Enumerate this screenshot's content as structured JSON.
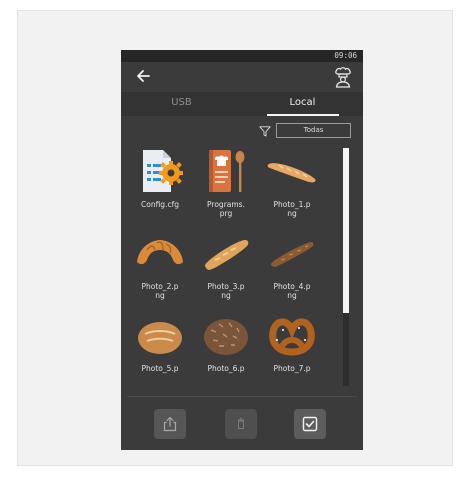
{
  "status": {
    "time": "09:06"
  },
  "header": {
    "back_icon": "arrow-left-icon",
    "user_icon": "chef-icon"
  },
  "tabs": [
    {
      "label": "USB",
      "active": false
    },
    {
      "label": "Local",
      "active": true
    }
  ],
  "filter": {
    "icon": "filter-funnel-icon",
    "selected": "Todas"
  },
  "files": [
    {
      "name": "Config.cfg",
      "icon": "config-file-icon"
    },
    {
      "name": "Programs.prg",
      "icon": "recipe-book-icon"
    },
    {
      "name": "Photo_1.png",
      "icon": "baguette-image"
    },
    {
      "name": "Photo_2.png",
      "icon": "croissant-image"
    },
    {
      "name": "Photo_3.png",
      "icon": "bread-loaf-image"
    },
    {
      "name": "Photo_4.png",
      "icon": "dark-baguette-image"
    },
    {
      "name": "Photo_5.png",
      "icon": "round-bread-image"
    },
    {
      "name": "Photo_6.png",
      "icon": "rye-bread-image"
    },
    {
      "name": "Photo_7.png",
      "icon": "pretzel-image"
    }
  ],
  "visible_labels": [
    "Config.cfg",
    "Programs.\nprg",
    "Photo_1.p\nng",
    "Photo_2.p\nng",
    "Photo_3.p\nng",
    "Photo_4.p\nng",
    "Photo_5.p",
    "Photo_6.p",
    "Photo_7.p"
  ],
  "actions": [
    {
      "name": "export",
      "icon": "share-upload-icon",
      "enabled": false
    },
    {
      "name": "delete",
      "icon": "trash-icon",
      "enabled": false
    },
    {
      "name": "select",
      "icon": "checkbox-icon",
      "enabled": true
    }
  ],
  "colors": {
    "background": "#3b3b3b",
    "tab_active": "#f5f5f5",
    "accent_gear": "#f39a1e",
    "accent_doc": "#2e8fd6"
  }
}
